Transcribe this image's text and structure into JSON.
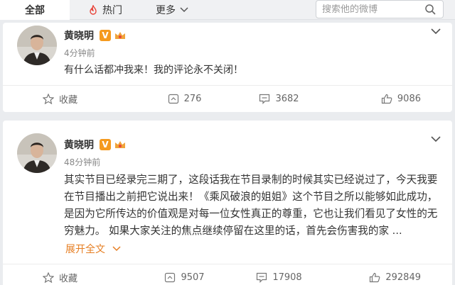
{
  "tabs": {
    "all_label": "全部",
    "hot_label": "热门",
    "more_label": "更多"
  },
  "search": {
    "placeholder": "搜索他的微博"
  },
  "posts": [
    {
      "author": "黄晓明",
      "verified_badge": "V",
      "time": "4分钟前",
      "text": "有什么话都冲我来！我的评论永不关闭！",
      "actions": {
        "favorite_label": "收藏",
        "repost_count": "276",
        "comment_count": "3682",
        "like_count": "9086"
      }
    },
    {
      "author": "黄晓明",
      "verified_badge": "V",
      "time": "48分钟前",
      "text": "其实节目已经录完三期了，这段话我在节目录制的时候其实已经说过了，今天我要在节目播出之前把它说出来！《乘风破浪的姐姐》这个节目之所以能够如此成功，是因为它所传达的价值观是对每一位女性真正的尊重，它也让我们看见了女性的无穷魅力。 如果大家关注的焦点继续停留在这里的话，首先会伤害我的家 ...",
      "expand_label": "展开全文",
      "actions": {
        "favorite_label": "收藏",
        "repost_count": "9507",
        "comment_count": "17908",
        "like_count": "292849"
      }
    }
  ],
  "colors": {
    "accent": "#e67e22",
    "verified": "#f59a1e",
    "background": "#eaecef"
  },
  "icons": {
    "hot": "fire-icon",
    "more": "chevron-down-icon",
    "search": "search-icon",
    "favorite": "star-icon",
    "repost": "repost-icon",
    "comment": "comment-icon",
    "like": "thumbs-up-icon"
  }
}
